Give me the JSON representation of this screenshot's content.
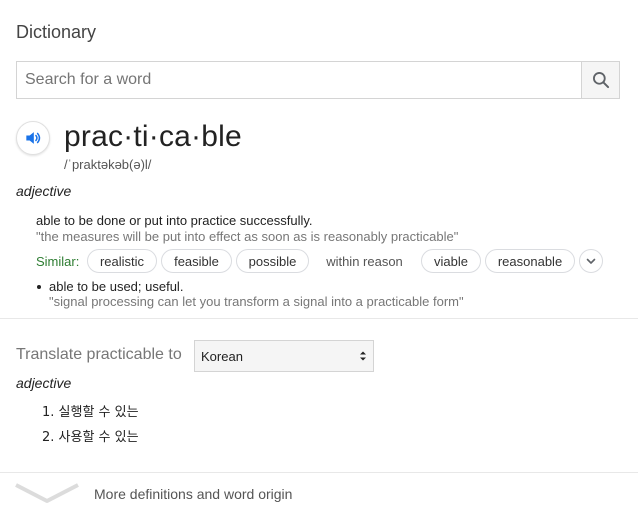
{
  "title": "Dictionary",
  "search": {
    "placeholder": "Search for a word",
    "value": ""
  },
  "icons": {
    "search": "search-icon",
    "speaker": "speaker-icon",
    "expand": "chevron-down-icon",
    "more": "chevron-down-icon"
  },
  "colors": {
    "accent_blue": "#1a73e8",
    "similar_green": "#2e7d32",
    "muted_text": "#777777"
  },
  "entry": {
    "headword": "prac·ti·ca·ble",
    "phonetic": "/ˈpraktəkəb(ə)l/",
    "part_of_speech": "adjective",
    "senses": [
      {
        "definition": "able to be done or put into practice successfully.",
        "example": "\"the measures will be put into effect as soon as is reasonably practicable\""
      },
      {
        "definition": "able to be used; useful.",
        "example": "\"signal processing can let you transform a signal into a practicable form\""
      }
    ],
    "similar_label": "Similar:",
    "similar": [
      "realistic",
      "feasible",
      "possible",
      "within reason",
      "viable",
      "reasonable"
    ]
  },
  "translate": {
    "label": "Translate practicable to",
    "language": "Korean",
    "part_of_speech": "adjective",
    "items": [
      "1. 실행할 수 있는",
      "2. 사용할 수 있는"
    ]
  },
  "more_link": "More definitions and word origin"
}
